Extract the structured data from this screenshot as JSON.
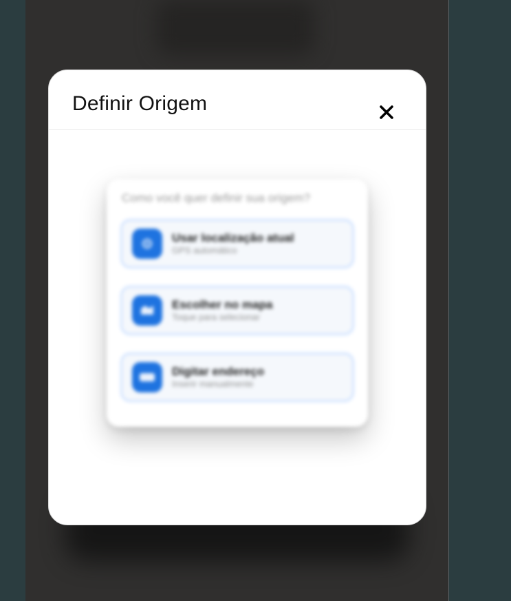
{
  "modal": {
    "title": "Definir Origem"
  },
  "preview": {
    "question": "Como você quer definir sua origem?",
    "options": [
      {
        "title": "Usar localização atual",
        "subtitle": "GPS automático",
        "icon": "location-icon"
      },
      {
        "title": "Escolher no mapa",
        "subtitle": "Toque para selecionar",
        "icon": "map-icon"
      },
      {
        "title": "Digitar endereço",
        "subtitle": "Inserir manualmente",
        "icon": "keyboard-icon"
      }
    ]
  },
  "colors": {
    "accent": "#1e73e0",
    "backdrop": "#2b3d40",
    "phone_bg": "#302f2e"
  }
}
